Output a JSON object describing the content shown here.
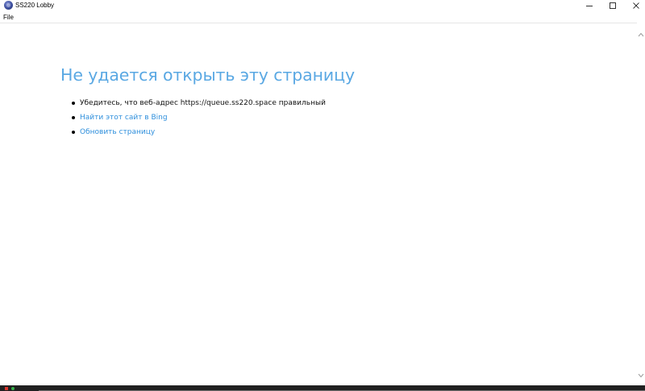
{
  "window": {
    "title": "SS220 Lobby",
    "icon": "ss220-logo-icon",
    "buttons": [
      "minimize",
      "maximize",
      "close"
    ]
  },
  "menu": {
    "items": [
      {
        "label": "File"
      }
    ]
  },
  "error_page": {
    "heading": "Не удается открыть эту страницу",
    "suggestions": [
      {
        "text": "Убедитесь, что веб-адрес https://queue.ss220.space правильный",
        "is_link": false
      },
      {
        "text": "Найти этот сайт в Bing",
        "is_link": true
      },
      {
        "text": "Обновить страницу",
        "is_link": true
      }
    ]
  },
  "colors": {
    "heading": "#5aa8e3",
    "link": "#2f8fdc",
    "text": "#111111",
    "background": "#ffffff",
    "taskbar": "#202020"
  }
}
